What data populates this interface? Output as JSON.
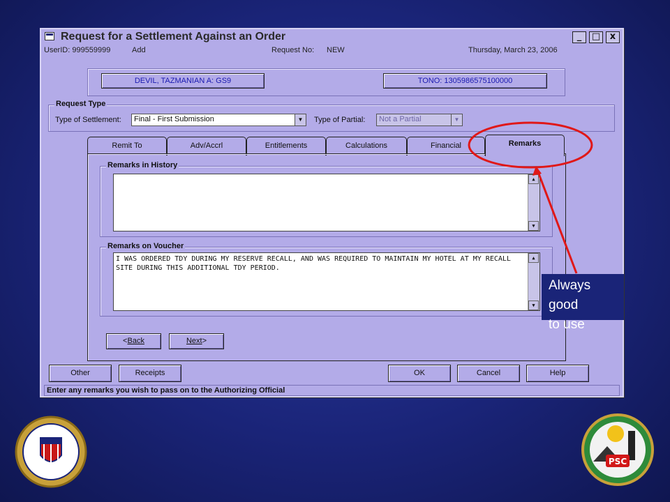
{
  "window": {
    "title": "Request for a Settlement Against an Order",
    "controls": {
      "minimize": "_",
      "maximize": "□",
      "close": "x"
    }
  },
  "infobar": {
    "user": "UserID:  999559999",
    "mode": "Add",
    "request_label": "Request No:",
    "request_no": "NEW",
    "date": "Thursday, March 23, 2006"
  },
  "member_button": "DEVIL, TAZMANIAN A: GS9",
  "tono_button": "TONO: 1305986575100000",
  "request_type": {
    "group_label": "Request Type",
    "settlement_label": "Type of Settlement:",
    "settlement_value": "Final - First Submission",
    "partial_label": "Type of Partial:",
    "partial_value": "Not a Partial"
  },
  "tabs": [
    {
      "label": "Remit To"
    },
    {
      "label": "Adv/Accrl"
    },
    {
      "label": "Entitlements"
    },
    {
      "label": "Calculations"
    },
    {
      "label": "Financial"
    },
    {
      "label": "Remarks",
      "active": true
    }
  ],
  "remarks_history": {
    "label": "Remarks in History",
    "value": ""
  },
  "remarks_voucher": {
    "label": "Remarks on Voucher",
    "value": "I WAS ORDERED TDY DURING MY RESERVE RECALL, AND WAS REQUIRED TO MAINTAIN MY HOTEL AT MY RECALL SITE DURING THIS ADDITIONAL TDY PERIOD."
  },
  "nav": {
    "back": "Back",
    "next": "Next"
  },
  "bottom_buttons": {
    "other": "Other",
    "receipts": "Receipts",
    "ok": "OK",
    "cancel": "Cancel",
    "help": "Help"
  },
  "status": "Enter any remarks you wish to pass on to the Authorizing Official",
  "callout": {
    "line1": "Always good",
    "line2": "to use"
  },
  "logos": {
    "left": "UNITED STATES COAST GUARD",
    "right": "PSC Personnel Service Center TOPEKA"
  },
  "colors": {
    "slide_bg": "#1a2478",
    "window_bg": "#b3abe8",
    "highlight": "#e01818"
  },
  "icons": [
    "window-icon",
    "chevron-down-icon",
    "chevron-up-icon"
  ]
}
